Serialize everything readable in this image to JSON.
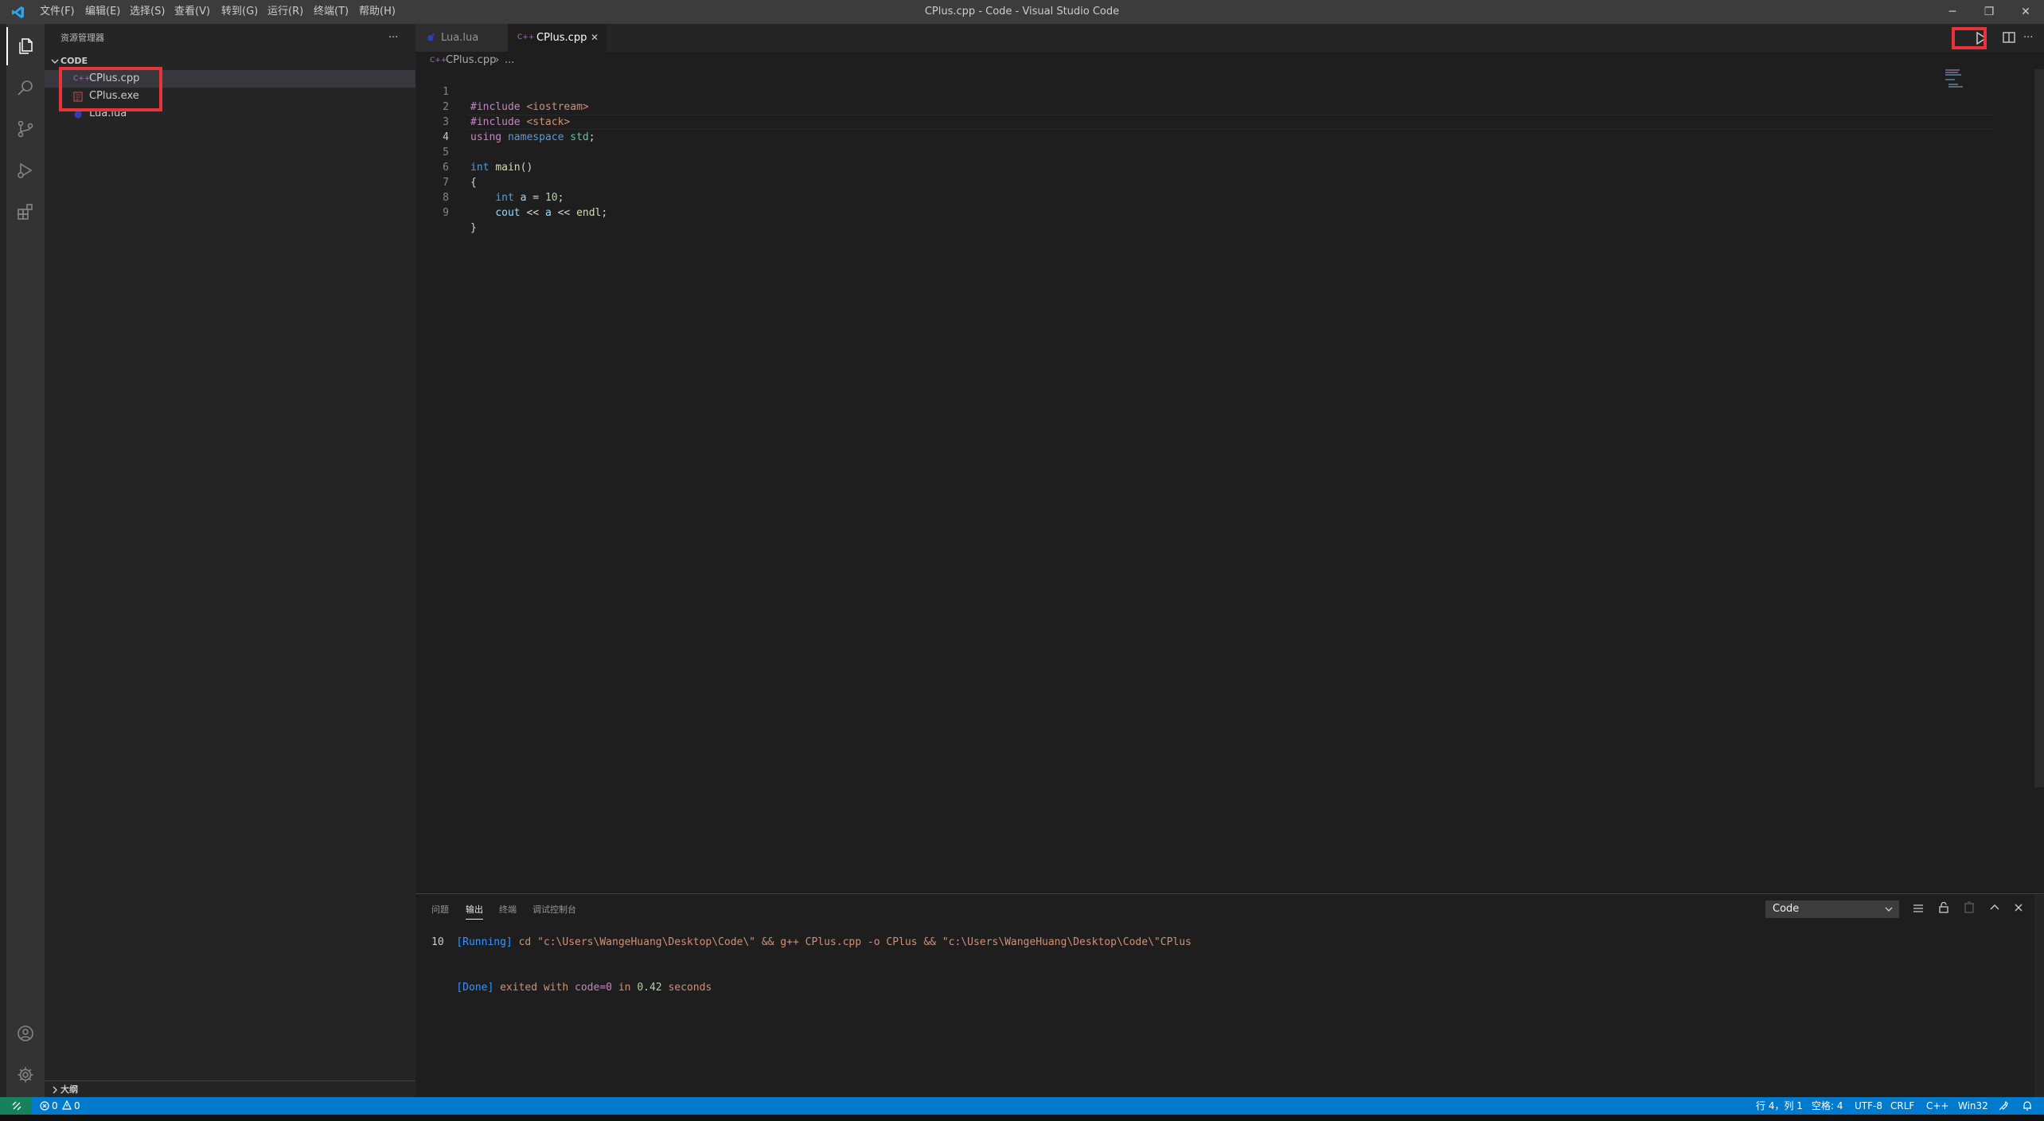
{
  "window": {
    "title": "CPlus.cpp - Code - Visual Studio Code",
    "menu": [
      "文件(F)",
      "编辑(E)",
      "选择(S)",
      "查看(V)",
      "转到(G)",
      "运行(R)",
      "终端(T)",
      "帮助(H)"
    ],
    "controls": {
      "minimize": "─",
      "restore": "❐",
      "close": "✕"
    }
  },
  "sidebar": {
    "title": "资源管理器",
    "more": "···",
    "folder": "CODE",
    "files": [
      {
        "name": "CPlus.cpp",
        "icon": "C++"
      },
      {
        "name": "CPlus.exe",
        "icon": "exe"
      },
      {
        "name": "Lua.lua",
        "icon": "lua"
      }
    ],
    "outline": "大纲"
  },
  "tabs": [
    {
      "label": "Lua.lua",
      "icon": "lua",
      "active": false
    },
    {
      "label": "CPlus.cpp",
      "icon": "C++",
      "active": true,
      "close": "✕"
    }
  ],
  "breadcrumb": {
    "icon": "C++",
    "file": "CPlus.cpp",
    "sep": "›",
    "rest": "..."
  },
  "editor": {
    "line_numbers": [
      "1",
      "2",
      "3",
      "4",
      "5",
      "6",
      "7",
      "8",
      "9"
    ],
    "lines": [
      "#include <iostream>",
      "#include <stack>",
      "using namespace std;",
      "",
      "int main()",
      "{",
      "    int a = 10;",
      "    cout << a << endl;",
      "}"
    ]
  },
  "panel": {
    "tabs": [
      "问题",
      "输出",
      "终端",
      "调试控制台"
    ],
    "active_tab": "输出",
    "channel": "Code",
    "output": {
      "running_tag": "[Running]",
      "command": " cd \"c:\\Users\\WangeHuang\\Desktop\\Code\\\" && g++ CPlus.cpp -o CPlus && \"c:\\Users\\WangeHuang\\Desktop\\Code\\\"CPlus",
      "result": "10",
      "done_tag": "[Done]",
      "done_text": " exited with ",
      "code_text": "code=0",
      "in_text": " in ",
      "seconds_value": "0.42",
      "seconds_text": " seconds"
    }
  },
  "statusbar": {
    "errors": "0",
    "warnings": "0",
    "position": "行 4，列 1",
    "spaces": "空格: 4",
    "encoding": "UTF-8",
    "eol": "CRLF",
    "language": "C++",
    "platform": "Win32"
  },
  "colors": {
    "accent": "#007acc",
    "highlight_box": "#e8333a",
    "titlebar": "#3c3c3c",
    "activitybar": "#333333",
    "sidebar": "#252526",
    "editor": "#1e1e1e"
  }
}
